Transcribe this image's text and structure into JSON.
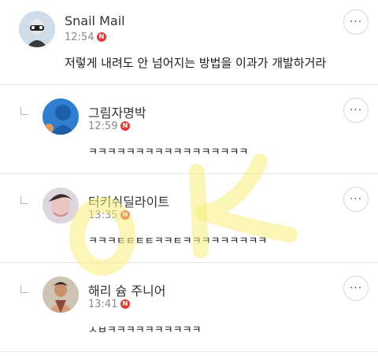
{
  "comments": [
    {
      "author": "Snail Mail",
      "time": "12:54",
      "badge": "N",
      "text": "저렇게 내려도 안 넘어지는 방법을 이과가 개발하거라",
      "more": "···"
    },
    {
      "author": "그림자명박",
      "time": "12:59",
      "badge": "N",
      "text": "ㅋㅋㅋㅋㅋㅋㅋㅋㅋㅋㅋㅋㅋㅋㅋㅋㅋ",
      "more": "···"
    },
    {
      "author": "터키쉬딜라이트",
      "time": "13:35",
      "badge": "N",
      "text": "ㅋㅋㅋㅌㅌㅌㅌㅋㅋㅌㅋㅋㅋㅋㅋㅋㅋㅋㅋ",
      "more": "···"
    },
    {
      "author": "해리 슘 주니어",
      "time": "13:41",
      "badge": "N",
      "text": "ㅅㅂㅋㅋㅋㅋㅋㅋㅋㅋㅋㅋ",
      "more": "···"
    }
  ],
  "colors": {
    "badge": "#e53935",
    "watermark": "#f7ef7a",
    "divider": "#e6e6e6"
  },
  "icons": {
    "more": "more-dots-icon",
    "reply": "reply-arrow-icon",
    "new": "new-badge-icon"
  }
}
